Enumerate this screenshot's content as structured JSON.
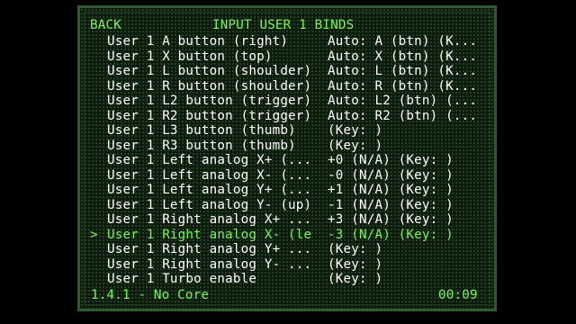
{
  "header": {
    "back_label": "BACK",
    "title": "INPUT USER 1 BINDS"
  },
  "cursor_glyph": ">",
  "selected_index": 13,
  "binds": [
    {
      "label": "User 1 A button (right)",
      "value": "Auto: A (btn) (K..."
    },
    {
      "label": "User 1 X button (top)",
      "value": "Auto: X (btn) (K..."
    },
    {
      "label": "User 1 L button (shoulder)",
      "value": "Auto: L (btn) (K..."
    },
    {
      "label": "User 1 R button (shoulder)",
      "value": "Auto: R (btn) (K..."
    },
    {
      "label": "User 1 L2 button (trigger)",
      "value": "Auto: L2 (btn) (..."
    },
    {
      "label": "User 1 R2 button (trigger)",
      "value": "Auto: R2 (btn) (..."
    },
    {
      "label": "User 1 L3 button (thumb)",
      "value": "(Key: )"
    },
    {
      "label": "User 1 R3 button (thumb)",
      "value": "(Key: )"
    },
    {
      "label": "User 1 Left analog X+ (...",
      "value": "+0 (N/A) (Key: )"
    },
    {
      "label": "User 1 Left analog X- (...",
      "value": "-0 (N/A) (Key: )"
    },
    {
      "label": "User 1 Left analog Y+ (...",
      "value": "+1 (N/A) (Key: )"
    },
    {
      "label": "User 1 Left analog Y- (up)",
      "value": "-1 (N/A) (Key: )"
    },
    {
      "label": "User 1 Right analog X+ ...",
      "value": "+3 (N/A) (Key: )"
    },
    {
      "label": "User 1 Right analog X- (le",
      "value": "-3 (N/A) (Key: )"
    },
    {
      "label": "User 1 Right analog Y+ ...",
      "value": "(Key: )"
    },
    {
      "label": "User 1 Right analog Y- ...",
      "value": "(Key: )"
    },
    {
      "label": "User 1 Turbo enable",
      "value": "(Key: )"
    }
  ],
  "footer": {
    "version": "1.4.1 - No Core",
    "clock": "00:09"
  },
  "colors": {
    "highlight": "#7ef25c",
    "text": "#ffffff",
    "panel_border": "#2f5a2f",
    "background": "#000000"
  }
}
